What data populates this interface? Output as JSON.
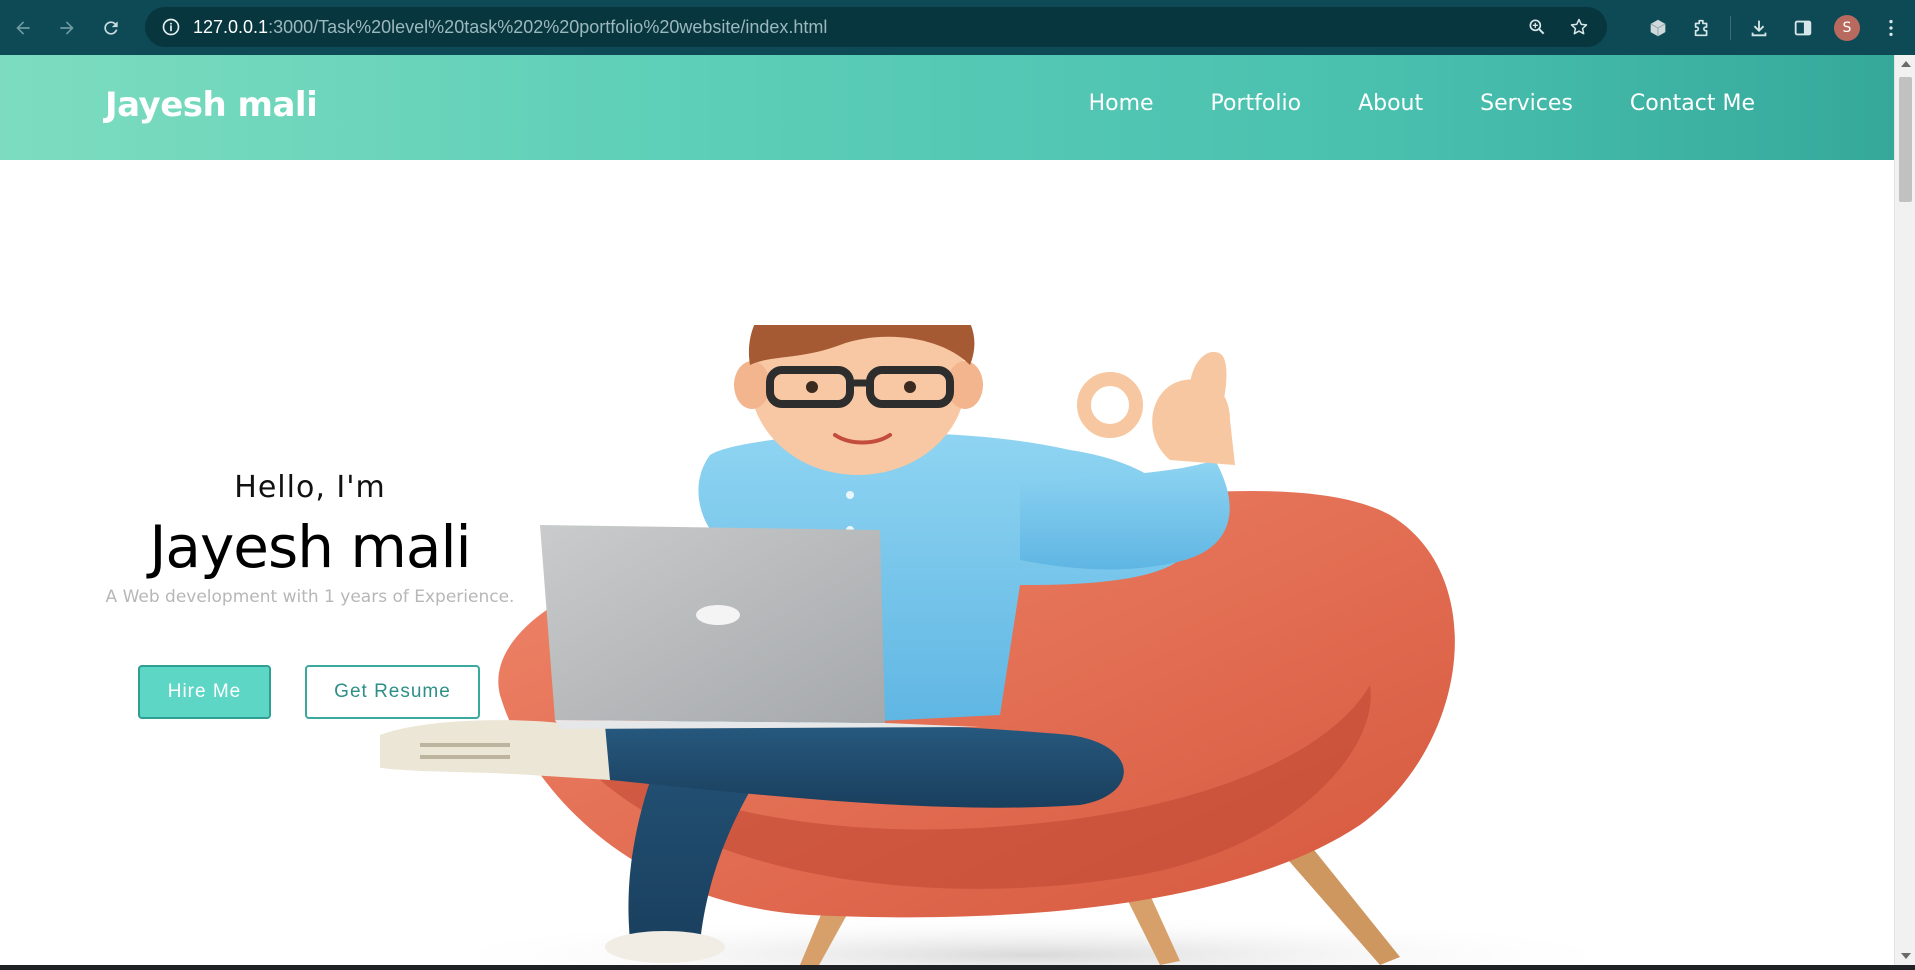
{
  "browser": {
    "url_host": "127.0.0.1",
    "url_rest": ":3000/Task%20level%20task%202%20portfolio%20website/index.html",
    "profile_initial": "S",
    "icons": [
      "back-icon",
      "forward-icon",
      "reload-icon",
      "site-info-icon",
      "zoom-icon",
      "bookmark-star-icon",
      "extension-cube-icon",
      "extensions-puzzle-icon",
      "download-icon",
      "side-panel-icon",
      "menu-dots-icon"
    ]
  },
  "site": {
    "logo": "Jayesh mali",
    "nav": [
      "Home",
      "Portfolio",
      "About",
      "Services",
      "Contact Me"
    ]
  },
  "hero": {
    "greeting": "Hello, I'm",
    "name": "Jayesh mali",
    "tagline": "A Web development with 1 years of Experience.",
    "hire_label": "Hire Me",
    "resume_label": "Get Resume",
    "image_subject": "3D cartoon man with glasses sitting in orange armchair with laptop, making OK gesture"
  },
  "colors": {
    "header_gradient_start": "#7ddcbf",
    "header_gradient_end": "#35a89a",
    "accent": "#5dd6c6",
    "browser_bar": "#0e4a55"
  }
}
